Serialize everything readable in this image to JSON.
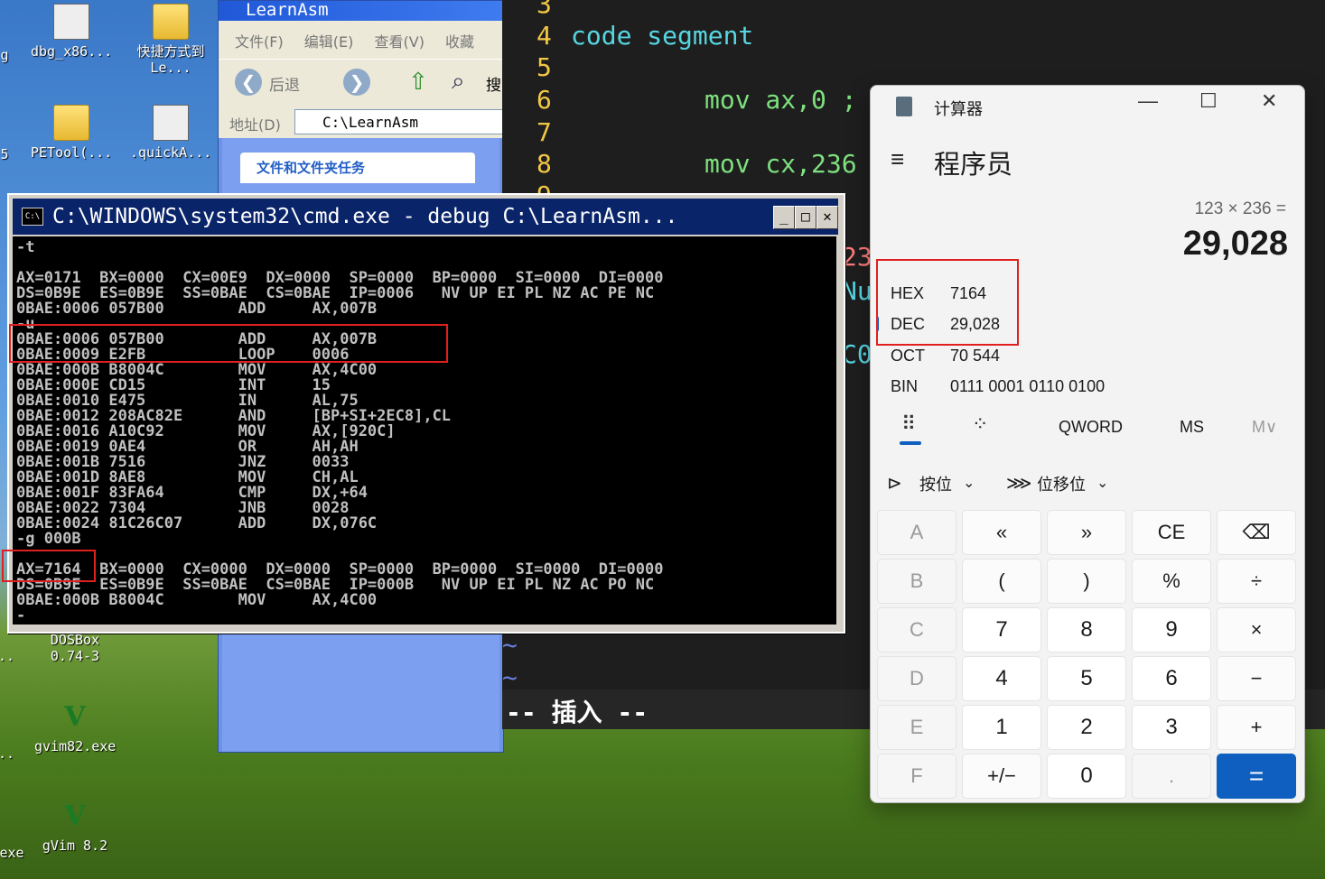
{
  "desktop": {
    "icons": [
      {
        "label": "dbg_x86...",
        "type": "app"
      },
      {
        "label": "快捷方式到 Le...",
        "type": "folder"
      },
      {
        "label": "PETool(...",
        "type": "folder"
      },
      {
        "label": ".quickA...",
        "type": "app"
      },
      {
        "label": "DOSBox 0.74-3",
        "type": "app"
      },
      {
        "label": "gvim82.exe",
        "type": "vim"
      },
      {
        "label": "gVim 8.2",
        "type": "vim"
      }
    ],
    "edge_labels": [
      "g",
      "5",
      "..",
      "..",
      "exe"
    ]
  },
  "explorer": {
    "title": "LearnAsm",
    "menu": [
      "文件(F)",
      "编辑(E)",
      "查看(V)",
      "收藏"
    ],
    "back_label": "后退",
    "search_label": "搜",
    "address_label": "地址(D)",
    "address_value": "C:\\LearnAsm",
    "task_header": "文件和文件夹任务"
  },
  "vim": {
    "lines": [
      {
        "num": "3",
        "text": ""
      },
      {
        "num": "4",
        "text": "code segment"
      },
      {
        "num": "5",
        "text": ""
      },
      {
        "num": "6",
        "text": "mov ax,0 ;"
      },
      {
        "num": "7",
        "text": ""
      },
      {
        "num": "8",
        "text": "mov cx,236"
      },
      {
        "num": "9",
        "text": ""
      }
    ],
    "partial_right": [
      "23",
      "Nu",
      "C0"
    ],
    "tildes": [
      "~",
      "~"
    ],
    "status": "-- 插入 --"
  },
  "cmd": {
    "title": "C:\\WINDOWS\\system32\\cmd.exe - debug C:\\LearnAsm...",
    "lines": [
      "-t",
      "",
      "AX=0171  BX=0000  CX=00E9  DX=0000  SP=0000  BP=0000  SI=0000  DI=0000",
      "DS=0B9E  ES=0B9E  SS=0BAE  CS=0BAE  IP=0006   NV UP EI PL NZ AC PE NC",
      "0BAE:0006 057B00        ADD     AX,007B",
      "-u",
      "0BAE:0006 057B00        ADD     AX,007B",
      "0BAE:0009 E2FB          LOOP    0006",
      "0BAE:000B B8004C        MOV     AX,4C00",
      "0BAE:000E CD15          INT     15",
      "0BAE:0010 E475          IN      AL,75",
      "0BAE:0012 208AC82E      AND     [BP+SI+2EC8],CL",
      "0BAE:0016 A10C92        MOV     AX,[920C]",
      "0BAE:0019 0AE4          OR      AH,AH",
      "0BAE:001B 7516          JNZ     0033",
      "0BAE:001D 8AE8          MOV     CH,AL",
      "0BAE:001F 83FA64        CMP     DX,+64",
      "0BAE:0022 7304          JNB     0028",
      "0BAE:0024 81C26C07      ADD     DX,076C",
      "-g 000B",
      "",
      "AX=7164  BX=0000  CX=0000  DX=0000  SP=0000  BP=0000  SI=0000  DI=0000",
      "DS=0B9E  ES=0B9E  SS=0BAE  CS=0BAE  IP=000B   NV UP EI PL NZ AC PO NC",
      "0BAE:000B B8004C        MOV     AX,4C00",
      "-"
    ]
  },
  "calculator": {
    "app_title": "计算器",
    "mode": "程序员",
    "expression": "123 × 236 =",
    "result": "29,028",
    "radix": [
      {
        "key": "HEX",
        "value": "7164"
      },
      {
        "key": "DEC",
        "value": "29,028"
      },
      {
        "key": "OCT",
        "value": "70 544"
      },
      {
        "key": "BIN",
        "value": "0111 0001 0110 0100"
      }
    ],
    "word_size": "QWORD",
    "ms": "MS",
    "mv": "M∨",
    "bitwise": "按位",
    "bitshift": "位移位",
    "keys": [
      [
        "A",
        "«",
        "»",
        "CE",
        "⌫"
      ],
      [
        "B",
        "(",
        ")",
        "%",
        "÷"
      ],
      [
        "C",
        "7",
        "8",
        "9",
        "×"
      ],
      [
        "D",
        "4",
        "5",
        "6",
        "−"
      ],
      [
        "E",
        "1",
        "2",
        "3",
        "+"
      ],
      [
        "F",
        "+/−",
        "0",
        ".",
        "="
      ]
    ]
  }
}
